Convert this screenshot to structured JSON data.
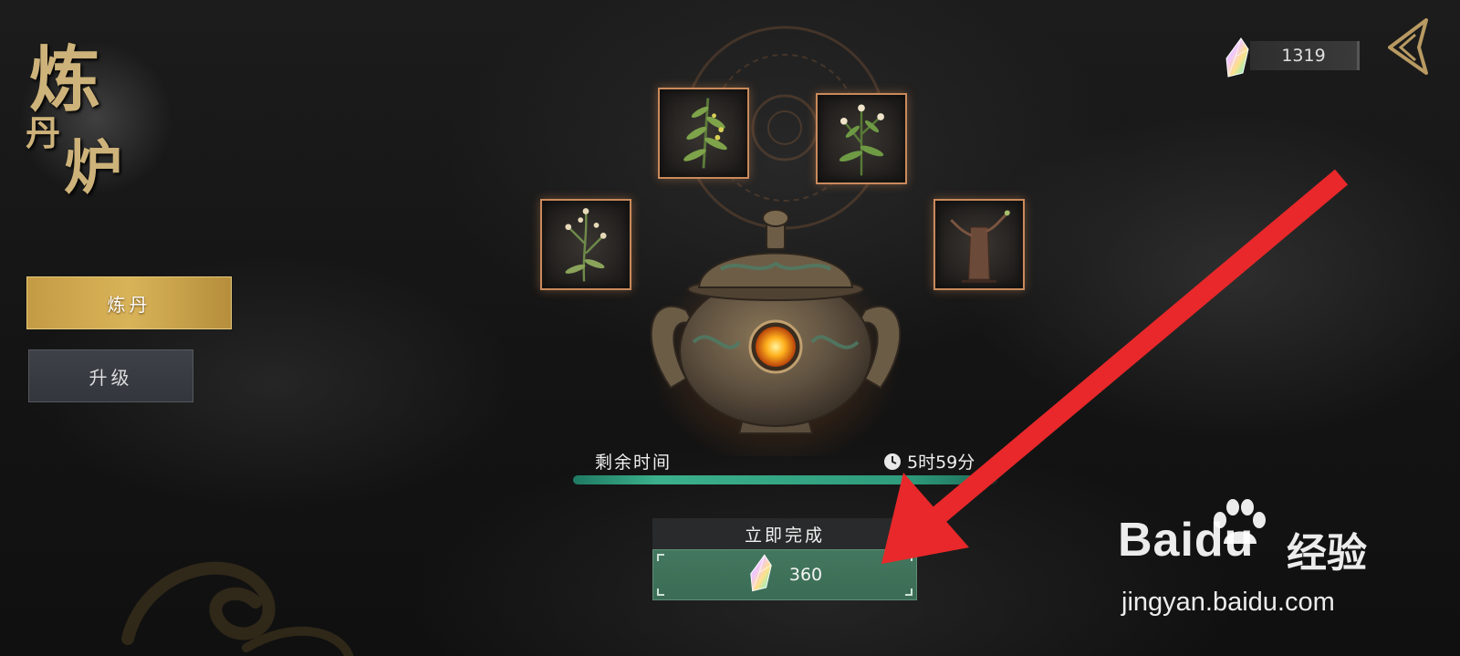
{
  "title": {
    "char1": "炼",
    "char2": "丹",
    "char3": "炉"
  },
  "side_tabs": [
    {
      "label": "炼丹",
      "active": true
    },
    {
      "label": "升级",
      "active": false
    }
  ],
  "currency": {
    "icon": "crystal-gem-icon",
    "amount": "1319"
  },
  "back_icon": "back-arrow-icon",
  "herbs": [
    {
      "icon": "herb-sprig-icon"
    },
    {
      "icon": "herb-flower-icon"
    },
    {
      "icon": "herb-stalk-icon"
    },
    {
      "icon": "tree-root-icon"
    }
  ],
  "furnace_icon": "alchemy-furnace-icon",
  "timer": {
    "label": "剩余时间",
    "value": "5时59分",
    "progress_fraction": 0.98
  },
  "finish": {
    "label": "立即完成",
    "cost": "360"
  },
  "watermark": {
    "logo": "Baidu",
    "cn": "经验",
    "url": "jingyan.baidu.com"
  },
  "colors": {
    "gold_tab": "#d9b358",
    "green_button": "#44775f",
    "progress": "#3bb08a",
    "annotation_arrow": "#e8282a"
  }
}
